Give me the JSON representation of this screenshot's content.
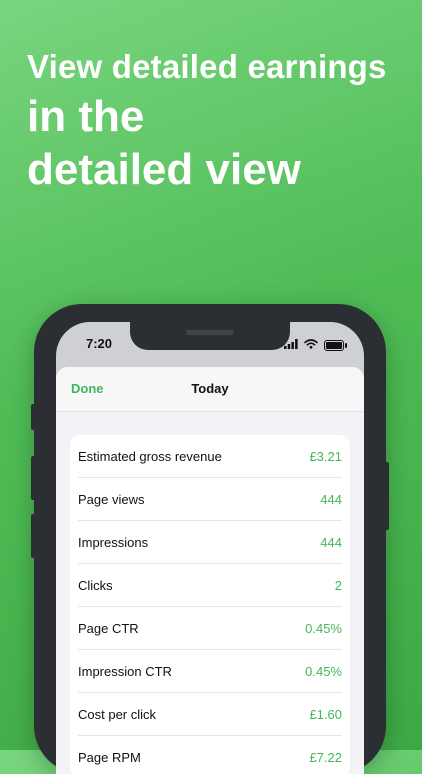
{
  "headline": {
    "line1": "View detailed earnings",
    "line2": "in the",
    "line3": "detailed view"
  },
  "status_bar": {
    "time": "7:20",
    "icons": [
      "signal-icon",
      "wifi-icon",
      "battery-icon"
    ]
  },
  "navbar": {
    "done_label": "Done",
    "title": "Today"
  },
  "metrics": [
    {
      "label": "Estimated gross revenue",
      "value": "£3.21"
    },
    {
      "label": "Page views",
      "value": "444"
    },
    {
      "label": "Impressions",
      "value": "444"
    },
    {
      "label": "Clicks",
      "value": "2"
    },
    {
      "label": "Page CTR",
      "value": "0.45%"
    },
    {
      "label": "Impression CTR",
      "value": "0.45%"
    },
    {
      "label": "Cost per click",
      "value": "£1.60"
    },
    {
      "label": "Page RPM",
      "value": "£7.22"
    }
  ],
  "colors": {
    "accent": "#43b55a",
    "background": "#5bc562"
  }
}
